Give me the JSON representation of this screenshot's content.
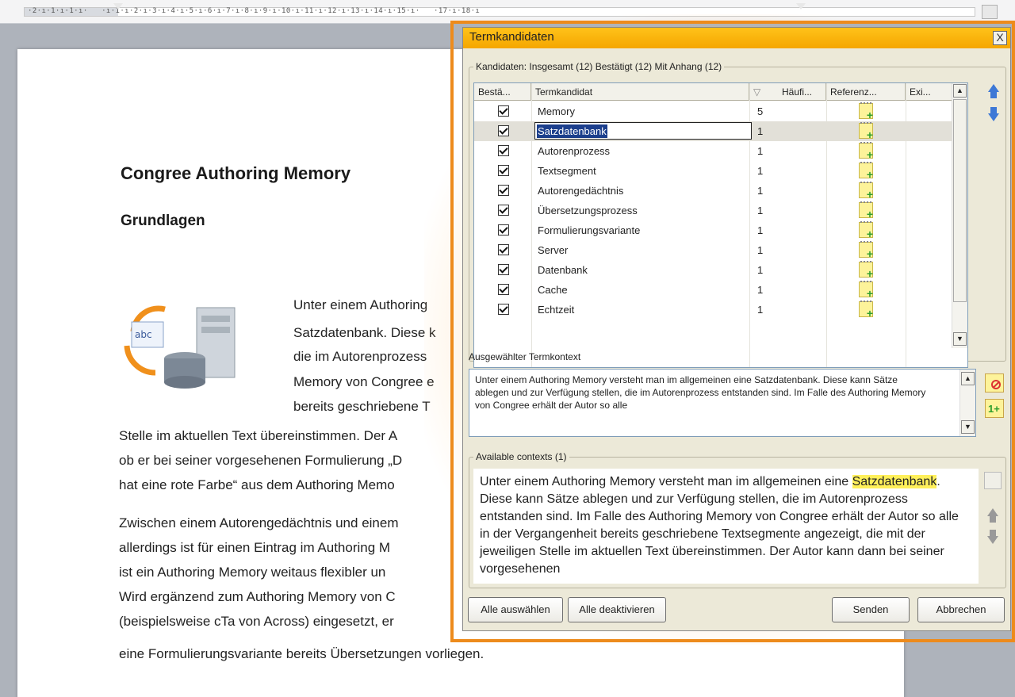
{
  "ruler": {
    "text": "·2·ı·1·ı·1·ı·   ·ı·1·ı·2·ı·3·ı·4·ı·5·ı·6·ı·7·ı·8·ı·9·ı·10·ı·11·ı·12·ı·13·ı·14·ı·15·ı·   ·17·ı·18·ı"
  },
  "document": {
    "title": "Congree Authoring Memory",
    "subtitle": "Grundlagen",
    "wrap_lines": [
      "Unter einem Authoring",
      "Satzdatenbank. Diese k",
      "die im Autorenprozess",
      "Memory von Congree e",
      "bereits geschriebene T"
    ],
    "full_lines": [
      "Stelle im aktuellen Text übereinstimmen. Der A",
      "ob er bei seiner vorgesehenen Formulierung „D",
      "hat eine rote Farbe“ aus dem Authoring Memo",
      "Zwischen einem Autorengedächtnis und einem",
      "allerdings ist für einen Eintrag im Authoring M",
      "ist ein Authoring Memory weitaus flexibler un",
      "Wird ergänzend zum Authoring Memory von C",
      "(beispielsweise cTa von Across) eingesetzt, er",
      "eine Formulierungsvariante bereits Übersetzungen vorliegen."
    ]
  },
  "dialog": {
    "title": "Termkandidaten",
    "close": "X",
    "candidates_group": "Kandidaten: Insgesamt (12) Bestätigt (12) Mit Anhang (12)",
    "columns": [
      "Bestä...",
      "Termkandidat",
      "▽",
      "Häufi...",
      "Referenz...",
      "Exi..."
    ],
    "rows": [
      {
        "term": "Memory",
        "freq": "5"
      },
      {
        "term": "Satzdatenbank",
        "freq": "1"
      },
      {
        "term": "Autorenprozess",
        "freq": "1"
      },
      {
        "term": "Textsegment",
        "freq": "1"
      },
      {
        "term": "Autorengedächtnis",
        "freq": "1"
      },
      {
        "term": "Übersetzungsprozess",
        "freq": "1"
      },
      {
        "term": "Formulierungsvariante",
        "freq": "1"
      },
      {
        "term": "Server",
        "freq": "1"
      },
      {
        "term": "Datenbank",
        "freq": "1"
      },
      {
        "term": "Cache",
        "freq": "1"
      },
      {
        "term": "Echtzeit",
        "freq": "1"
      }
    ],
    "context_label": "Ausgewählter Termkontext",
    "context_text": "Unter einem Authoring Memory versteht man im allgemeinen eine Satzdatenbank. Diese kann Sätze ablegen und zur Verfügung stellen, die im Autorenprozess entstanden sind. Im Falle des Authoring Memory von Congree erhält der Autor so alle",
    "available_label": "Available contexts (1)",
    "available_before": "Unter einem Authoring Memory versteht man im allgemeinen eine ",
    "available_highlight": "Satzdatenbank",
    "available_after": ". Diese kann Sätze ablegen und zur Verfügung stellen, die im Autorenprozess entstanden sind. Im Falle des Authoring Memory von Congree erhält der Autor so alle in der Vergangenheit bereits geschriebene Textsegmente angezeigt, die mit der jeweiligen Stelle im aktuellen Text übereinstimmen. Der Autor kann dann bei seiner vorgesehenen",
    "buttons": {
      "select_all": "Alle auswählen",
      "deselect_all": "Alle deaktivieren",
      "send": "Senden",
      "cancel": "Abbrechen"
    }
  },
  "colors": {
    "accent_orange": "#ed8b1c",
    "title_bar": "#f5a600",
    "highlight": "#fff05a",
    "selection": "#1c3f8c"
  }
}
